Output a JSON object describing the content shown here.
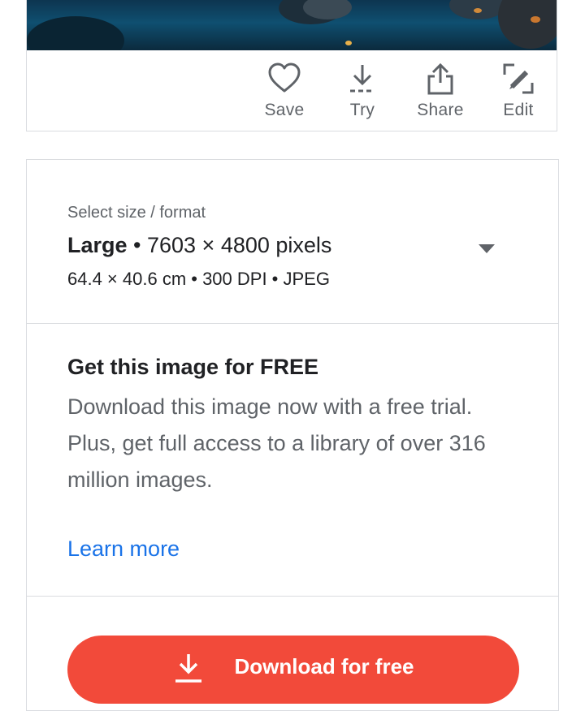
{
  "actions": {
    "save": {
      "label": "Save",
      "icon": "heart-icon"
    },
    "try": {
      "label": "Try",
      "icon": "download-icon"
    },
    "share": {
      "label": "Share",
      "icon": "share-icon"
    },
    "edit": {
      "label": "Edit",
      "icon": "edit-icon"
    }
  },
  "size_format": {
    "caption": "Select size / format",
    "size_name": "Large",
    "pixels": " • 7603 × 4800 pixels",
    "details": "64.4 × 40.6 cm • 300 DPI • JPEG"
  },
  "free_offer": {
    "title": "Get this image for FREE",
    "line1": "Download this image now with a free trial.",
    "line2": "Plus, get full access to a library of over 316 million images.",
    "learn_more": "Learn more"
  },
  "download_button": {
    "label": "Download for free",
    "icon": "download-icon"
  },
  "colors": {
    "accent": "#f24a3a",
    "link": "#1a73e8",
    "muted_text": "#5f6368",
    "border": "#dadce0"
  }
}
